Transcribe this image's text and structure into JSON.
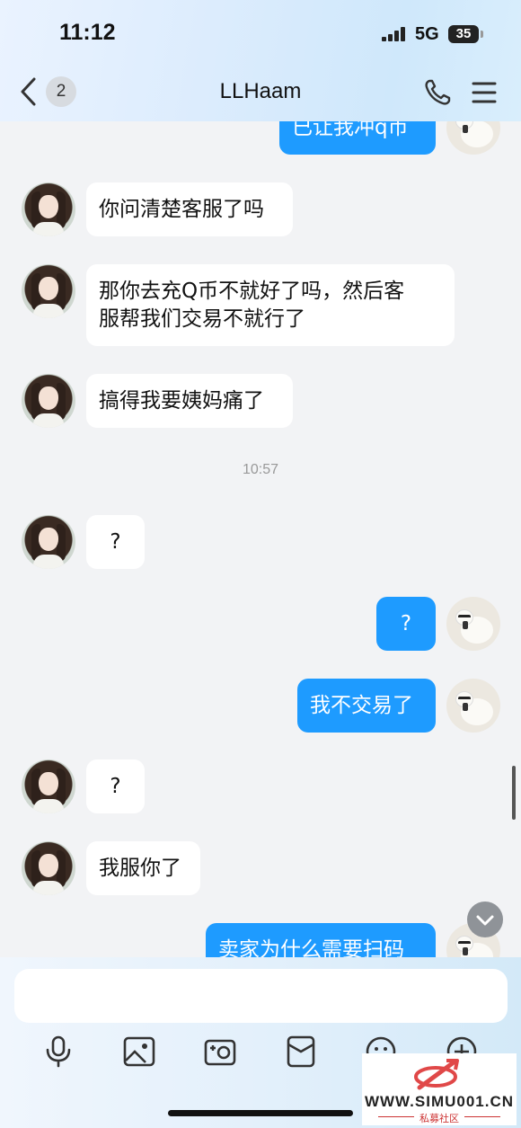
{
  "status_bar": {
    "time": "11:12",
    "network": "5G",
    "battery": "35"
  },
  "header": {
    "back_count": "2",
    "title": "LLHaam"
  },
  "messages": [
    {
      "from": "me",
      "text": "已让我冲q币"
    },
    {
      "from": "other",
      "text": "你问清楚客服了吗"
    },
    {
      "from": "other",
      "text": "那你去充Q币不就好了吗，然后客",
      "text2": "服帮我们交易不就行了"
    },
    {
      "from": "other",
      "text": "搞得我要姨妈痛了"
    },
    {
      "timestamp": "10:57"
    },
    {
      "from": "other",
      "text": "?"
    },
    {
      "from": "me",
      "text": "?"
    },
    {
      "from": "me",
      "text": "我不交易了"
    },
    {
      "from": "other",
      "text": "?"
    },
    {
      "from": "other",
      "text": "我服你了"
    },
    {
      "from": "me",
      "text": "卖家为什么需要扫码"
    }
  ],
  "toolbar": [
    "microphone-icon",
    "image-icon",
    "camera-icon",
    "red-packet-icon",
    "emoji-icon",
    "plus-icon"
  ],
  "watermark": {
    "url": "WWW.SIMU001.CN",
    "sub": "私募社区"
  },
  "colors": {
    "outgoing_bubble": "#1e9bff",
    "incoming_bubble": "#ffffff",
    "background": "#f2f3f5"
  }
}
